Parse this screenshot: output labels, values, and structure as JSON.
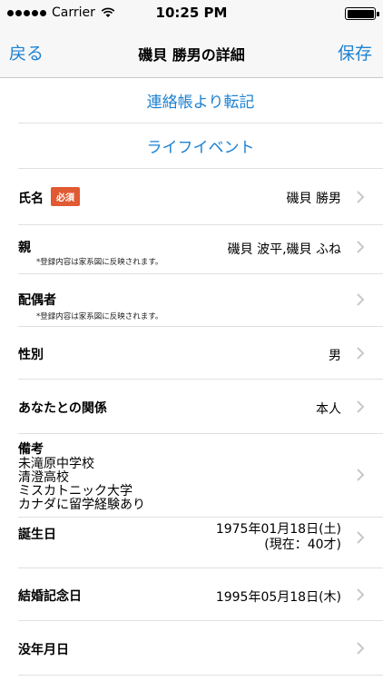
{
  "status": {
    "carrier": "Carrier",
    "time": "10:25 PM"
  },
  "nav": {
    "back_label": "戻る",
    "title": "磯貝 勝男の詳細",
    "save_label": "保存"
  },
  "actions": {
    "transfer_label": "連絡帳より転記",
    "life_event_label": "ライフイベント"
  },
  "fields": {
    "name": {
      "label": "氏名",
      "required_badge": "必須",
      "value": "磯貝 勝男"
    },
    "parents": {
      "label": "親",
      "value": "磯貝 波平,磯貝 ふね",
      "note": "*登録内容は家系図に反映されます。"
    },
    "spouse": {
      "label": "配偶者",
      "value": "",
      "note": "*登録内容は家系図に反映されます。"
    },
    "gender": {
      "label": "性別",
      "value": "男"
    },
    "relation": {
      "label": "あなたとの関係",
      "value": "本人"
    },
    "memo": {
      "label": "備考",
      "lines": [
        "未滝原中学校",
        "清澄高校",
        "ミスカトニック大学",
        "カナダに留学経験あり"
      ]
    },
    "birthday": {
      "label": "誕生日",
      "value": "1975年01月18日(土)",
      "sub_value": "(現在：40才)"
    },
    "anniversary": {
      "label": "結婚記念日",
      "value": "1995年05月18日(木)"
    },
    "death": {
      "label": "没年月日",
      "value": ""
    }
  },
  "colors": {
    "accent": "#1e82d2",
    "badge": "#e05a33"
  },
  "icons": {
    "chevron": "chevron-right-icon",
    "wifi": "wifi-icon",
    "battery": "battery-icon"
  }
}
